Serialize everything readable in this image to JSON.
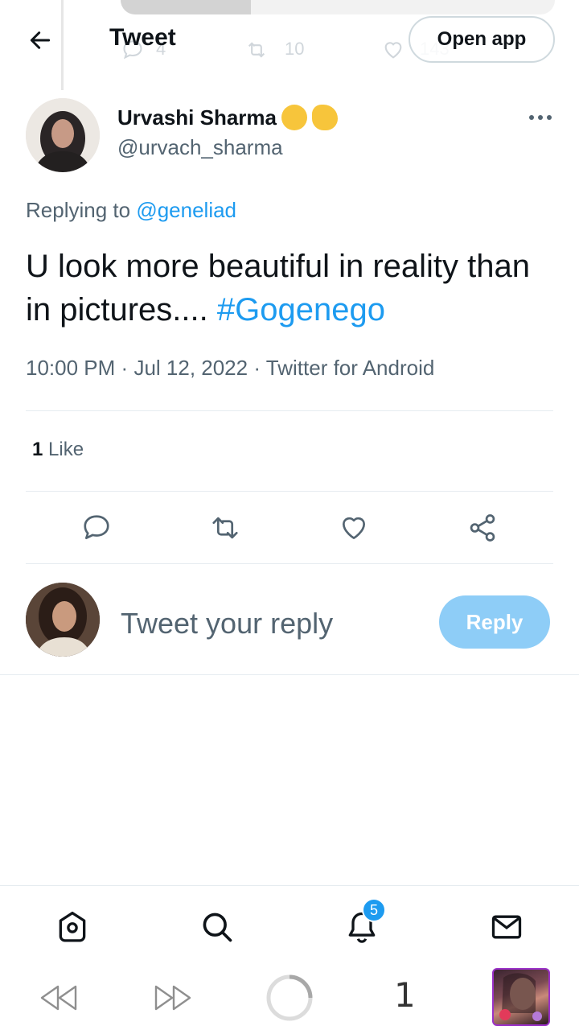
{
  "background_tweet": {
    "reply_count": "4",
    "retweet_count": "10",
    "like_count": "143"
  },
  "header": {
    "title": "Tweet",
    "open_app_label": "Open app"
  },
  "author": {
    "name": "Urvashi Sharma",
    "handle": "@urvach_sharma",
    "emojis": [
      "flexed-biceps",
      "call-me-hand"
    ]
  },
  "replying": {
    "prefix": "Replying to",
    "mention": "@geneliad"
  },
  "tweet": {
    "text": "U look more beautiful in reality than in pictures.... ",
    "hashtag": "#Gogenego",
    "time": "10:00 PM",
    "date": "Jul 12, 2022",
    "source": "Twitter for Android",
    "separator": "·"
  },
  "stats": {
    "likes_count": "1",
    "likes_label": "Like"
  },
  "actions": [
    "reply-icon",
    "retweet-icon",
    "like-icon",
    "share-icon"
  ],
  "reply_box": {
    "placeholder": "Tweet your reply",
    "button_label": "Reply"
  },
  "bottom_nav": {
    "items": [
      "home-icon",
      "search-icon",
      "notifications-icon",
      "messages-icon"
    ],
    "notification_badge": "5"
  },
  "system_bar": {
    "tab_count": "1"
  },
  "colors": {
    "accent": "#1d9bf0",
    "reply_button_disabled": "#8ecdf7",
    "secondary_text": "#536471",
    "primary_text": "#0f1419"
  }
}
